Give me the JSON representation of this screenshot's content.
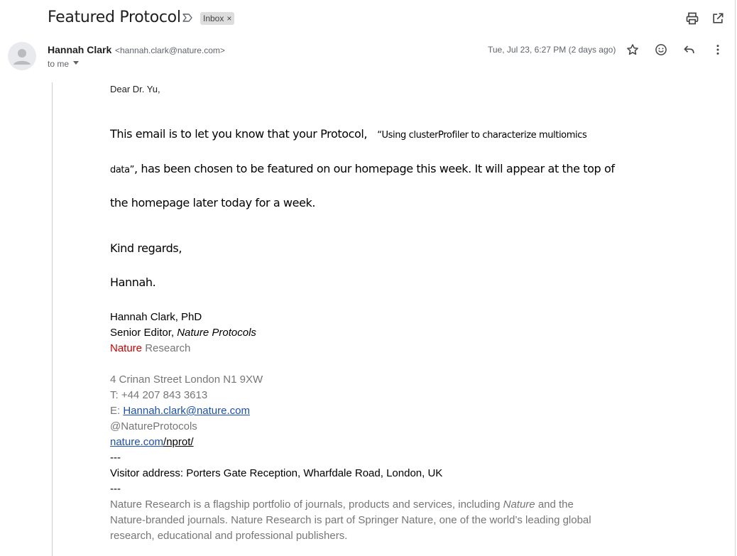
{
  "header": {
    "subject": "Featured Protocol",
    "label": "Inbox",
    "label_remove": "×"
  },
  "sender": {
    "name": "Hannah Clark",
    "email": "<hannah.clark@nature.com>",
    "to": "to me",
    "date": "Tue, Jul 23, 6:27 PM (2 days ago)"
  },
  "body": {
    "greeting": "Dear Dr. Yu,",
    "p1_main": "This email is to let you know that your Protocol,",
    "p1_title": "“Using clusterProfiler to characterize multiomics",
    "p2_title": "data”",
    "p2_main": ", has been chosen to be featured on our homepage this week. It will appear at the top of",
    "p3": "the homepage later today for a week.",
    "closing": "Kind regards,",
    "signoff": "Hannah."
  },
  "signature": {
    "name_line": "Hannah Clark, PhD",
    "role_prefix": "Senior Editor, ",
    "role_journal": "Nature Protocols",
    "org_red": "Nature",
    "org_rest": " Research",
    "address": "4 Crinan Street London N1 9XW",
    "phone": "T: +44 207 843 3613",
    "email_prefix": "E: ",
    "email_link": "Hannah.clark@nature.com",
    "twitter": "@NatureProtocols",
    "web_link": "nature.com",
    "web_rest": "/nprot/ ",
    "sep1": "---",
    "visitor": "Visitor address: Porters Gate Reception, Wharfdale Road, London, UK",
    "sep2": "---",
    "about1_a": "Nature Research is a flagship portfolio of journals, products and services, including ",
    "about1_i": "Nature",
    "about1_b": " and the",
    "about2": "Nature-branded journals. Nature Research is part of Springer Nature, one of the world’s leading global",
    "about3": "research, educational and professional publishers."
  },
  "icons": {
    "importance": "importance-marker-icon",
    "print": "print-icon",
    "new_window": "open-in-new-window-icon",
    "avatar": "default-avatar-icon",
    "star": "star-icon",
    "emoji": "emoji-icon",
    "reply": "reply-icon",
    "more": "more-vert-icon"
  }
}
